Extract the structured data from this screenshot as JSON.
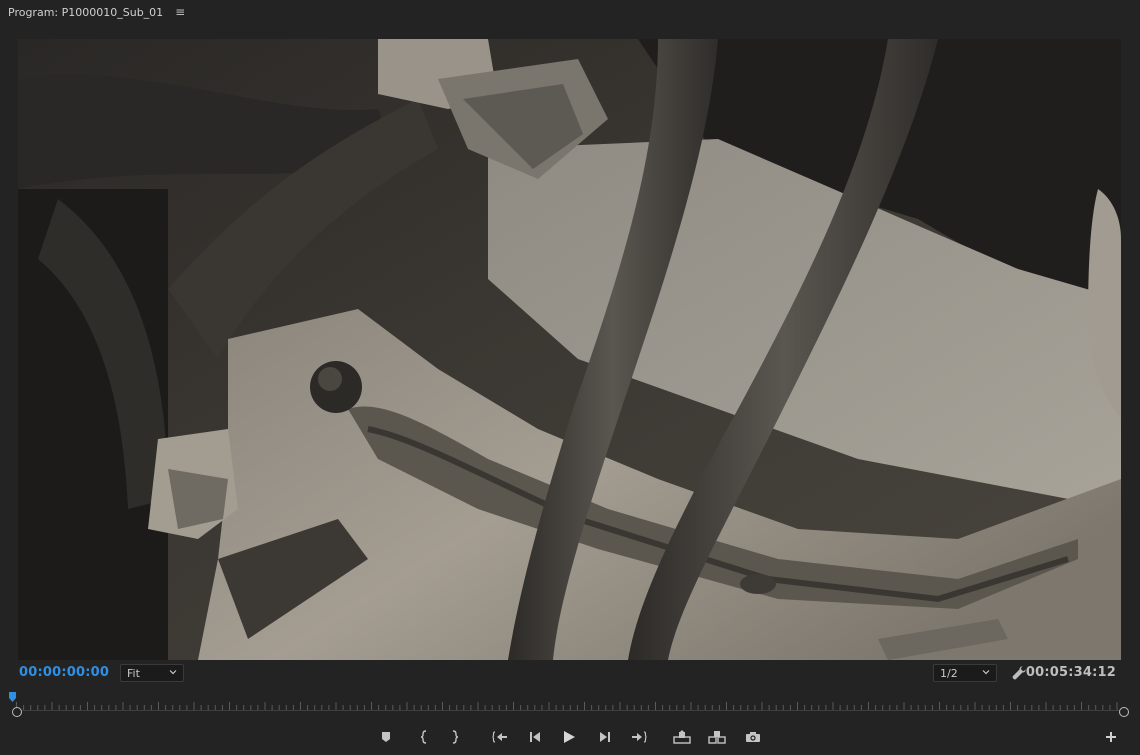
{
  "panel": {
    "title": "Program: P1000010_Sub_01",
    "menu_icon": "hamburger-menu-icon"
  },
  "viewer": {
    "content": "video-frame"
  },
  "controls": {
    "current_timecode": "00:00:00:00",
    "zoom_level": "Fit",
    "resolution": "1/2",
    "duration_timecode": "00:05:34:12",
    "settings_icon": "wrench-icon"
  },
  "timeline": {
    "playhead_position": 0
  },
  "transport": {
    "buttons": [
      {
        "name": "add-marker-button",
        "icon": "marker-icon"
      },
      {
        "name": "mark-in-button",
        "icon": "mark-in-icon"
      },
      {
        "name": "mark-out-button",
        "icon": "mark-out-icon"
      },
      {
        "name": "go-to-in-button",
        "icon": "go-to-in-icon"
      },
      {
        "name": "step-back-button",
        "icon": "step-back-icon"
      },
      {
        "name": "play-button",
        "icon": "play-icon"
      },
      {
        "name": "step-forward-button",
        "icon": "step-forward-icon"
      },
      {
        "name": "go-to-out-button",
        "icon": "go-to-out-icon"
      },
      {
        "name": "lift-button",
        "icon": "lift-icon"
      },
      {
        "name": "extract-button",
        "icon": "extract-icon"
      },
      {
        "name": "export-frame-button",
        "icon": "camera-icon"
      },
      {
        "name": "button-editor-button",
        "icon": "plus-icon"
      }
    ]
  },
  "colors": {
    "background": "#232323",
    "accent_timecode": "#2f8fe3",
    "text": "#bebebe"
  }
}
